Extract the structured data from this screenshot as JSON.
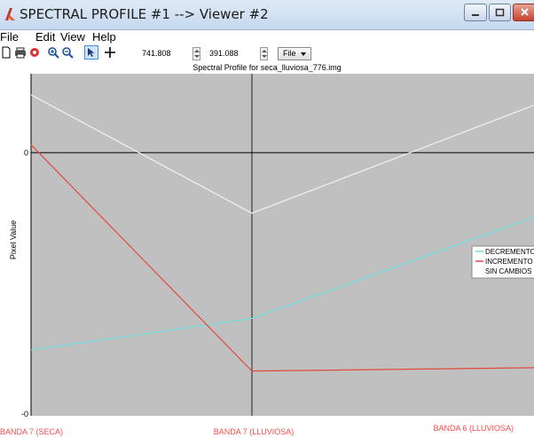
{
  "window": {
    "title": "SPECTRAL PROFILE #1 --> Viewer #2"
  },
  "menubar": {
    "items": [
      "File",
      "Edit",
      "View",
      "Help"
    ]
  },
  "toolbar": {
    "x_value": "741.808",
    "y_value": "391.088",
    "file_button": "File"
  },
  "icons": [
    "new-icon",
    "print-icon",
    "color-icon",
    "zoom-in-icon",
    "zoom-out-icon",
    "pointer-arrow-icon",
    "crosshair-icon"
  ],
  "colors": {
    "plot_background": "#c0c0c0",
    "decremento": "#6fdde0",
    "incremento": "#e04a3e",
    "sin_cambios": "#f2f2f2",
    "tick_labels": "#ff4a4a"
  },
  "chart_data": {
    "type": "line",
    "title": "Spectral Profile for seca_lluviosa_776.img",
    "xlabel": "",
    "ylabel": "Pixel Value",
    "categories": [
      "BANDA 7 (SECA)",
      "BANDA 7 (LLUVIOSA)",
      "BANDA 6 (LLUVIOSA)"
    ],
    "y_ticks": [
      "0",
      "-0"
    ],
    "ylim": [
      -1,
      0.3
    ],
    "grid": true,
    "legend_position": "right",
    "series": [
      {
        "name": "DECREMENTO",
        "values": [
          -0.75,
          -0.63,
          -0.33
        ]
      },
      {
        "name": "INCREMENTO",
        "values": [
          0.03,
          -0.83,
          -0.82
        ]
      },
      {
        "name": "SIN CAMBIOS",
        "values": [
          0.22,
          -0.23,
          0.09
        ]
      }
    ]
  }
}
